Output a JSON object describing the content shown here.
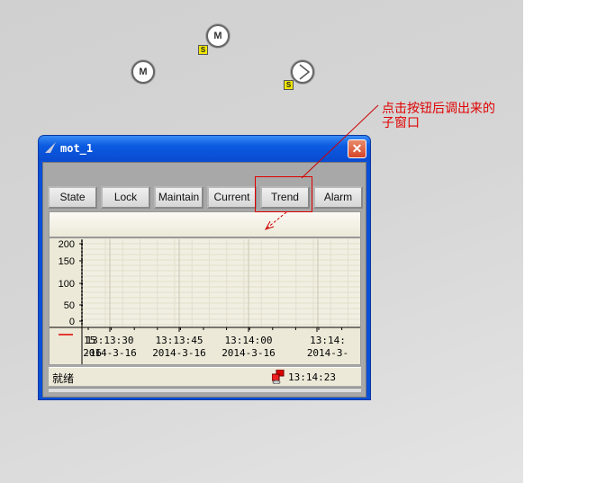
{
  "canvas": {
    "motors": [
      {
        "label": "M"
      },
      {
        "label": "M"
      }
    ],
    "status_badges": [
      "S",
      "S"
    ]
  },
  "window": {
    "title": "mot_1",
    "close_label": "✕",
    "buttons": [
      "State",
      "Lock",
      "Maintain",
      "Current",
      "Trend",
      "Alarm"
    ],
    "trend": {
      "y_ticks": [
        "200",
        "150",
        "100",
        "50",
        "0"
      ],
      "x_ticks": [
        {
          "time": "15",
          "date": "-16"
        },
        {
          "time": "13:13:30",
          "date": "2014-3-16"
        },
        {
          "time": "13:13:45",
          "date": "2014-3-16"
        },
        {
          "time": "13:14:00",
          "date": "2014-3-16"
        },
        {
          "time": "13:14:",
          "date": "2014-3-"
        }
      ],
      "legend_color": "#e00000"
    },
    "status": {
      "text": "就绪",
      "time": "13:14:23"
    }
  },
  "annotation": {
    "line1": "点击按钮后调出来的",
    "line2": "子窗口",
    "color": "#e00000"
  }
}
